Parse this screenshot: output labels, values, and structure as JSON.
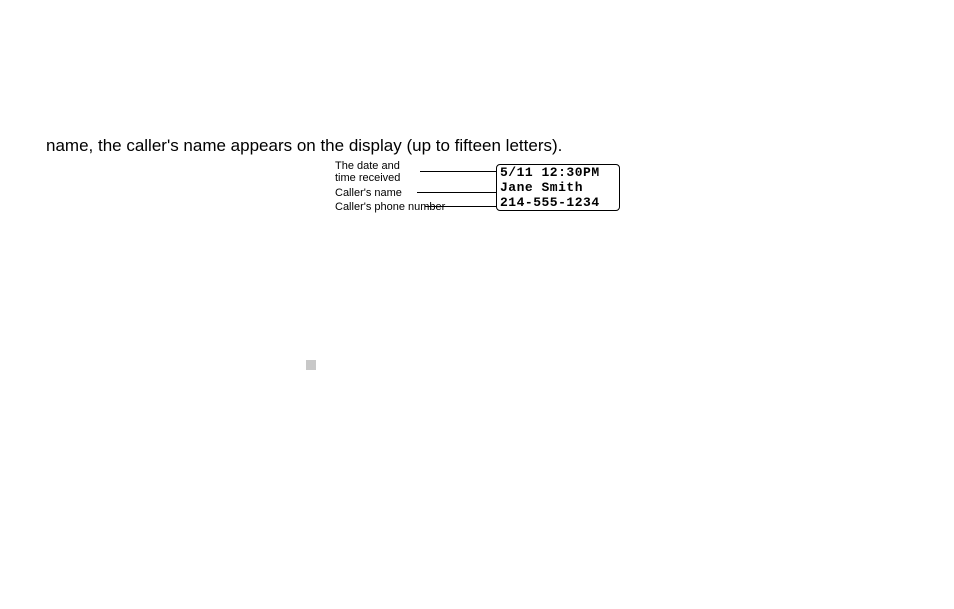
{
  "body_text": "name, the caller's name appears on the display (up to fifteen letters).",
  "labels": {
    "datetime_line1": "The date and",
    "datetime_line2": "time received",
    "name": "Caller's name",
    "phone": "Caller's phone number"
  },
  "display": {
    "line1": "5/11 12:30PM",
    "line2": "Jane Smith",
    "line3": "214-555-1234"
  }
}
